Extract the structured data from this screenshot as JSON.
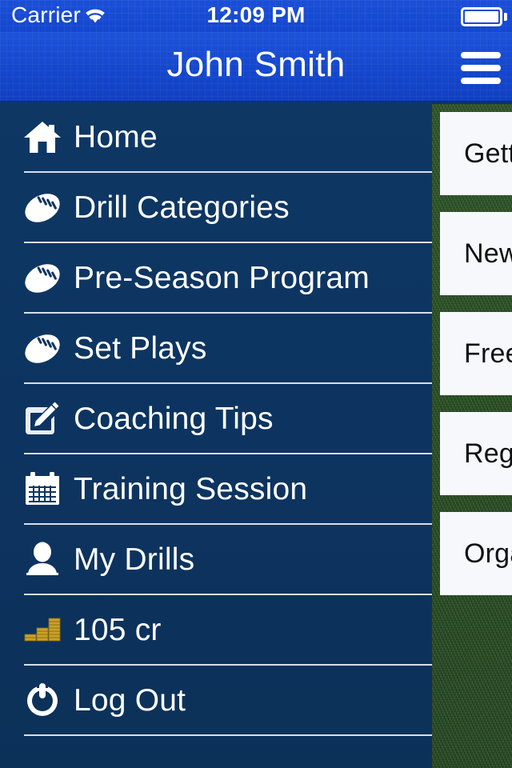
{
  "status_bar": {
    "carrier": "Carrier",
    "wifi_icon": "wifi-icon",
    "time": "12:09 PM",
    "battery_icon": "battery-full-icon"
  },
  "nav_bar": {
    "title": "John Smith",
    "menu_button_icon": "hamburger-menu-icon"
  },
  "sidebar": {
    "items": [
      {
        "label": "Home",
        "icon": "home-icon"
      },
      {
        "label": "Drill Categories",
        "icon": "football-icon"
      },
      {
        "label": "Pre-Season Program",
        "icon": "football-icon"
      },
      {
        "label": "Set Plays",
        "icon": "football-icon"
      },
      {
        "label": "Coaching Tips",
        "icon": "edit-square-icon"
      },
      {
        "label": "Training Session",
        "icon": "calendar-icon"
      },
      {
        "label": "My Drills",
        "icon": "user-icon"
      },
      {
        "label": "105 cr",
        "icon": "coin-stack-icon"
      },
      {
        "label": "Log Out",
        "icon": "power-icon"
      }
    ]
  },
  "content_panel": {
    "background": "grass-texture",
    "cards": [
      {
        "label": "Getting Started"
      },
      {
        "label": "New Drills"
      },
      {
        "label": "Free Drills"
      },
      {
        "label": "Register"
      },
      {
        "label": "Organise"
      }
    ]
  },
  "colors": {
    "status_bar_blue": "#1b4fd6",
    "nav_bar_blue": "#1547cd",
    "sidebar_navy": "#0d3563",
    "grass_green": "#2f5529",
    "card_white": "#f7f8fb",
    "coin_gold": "#c9a227"
  }
}
